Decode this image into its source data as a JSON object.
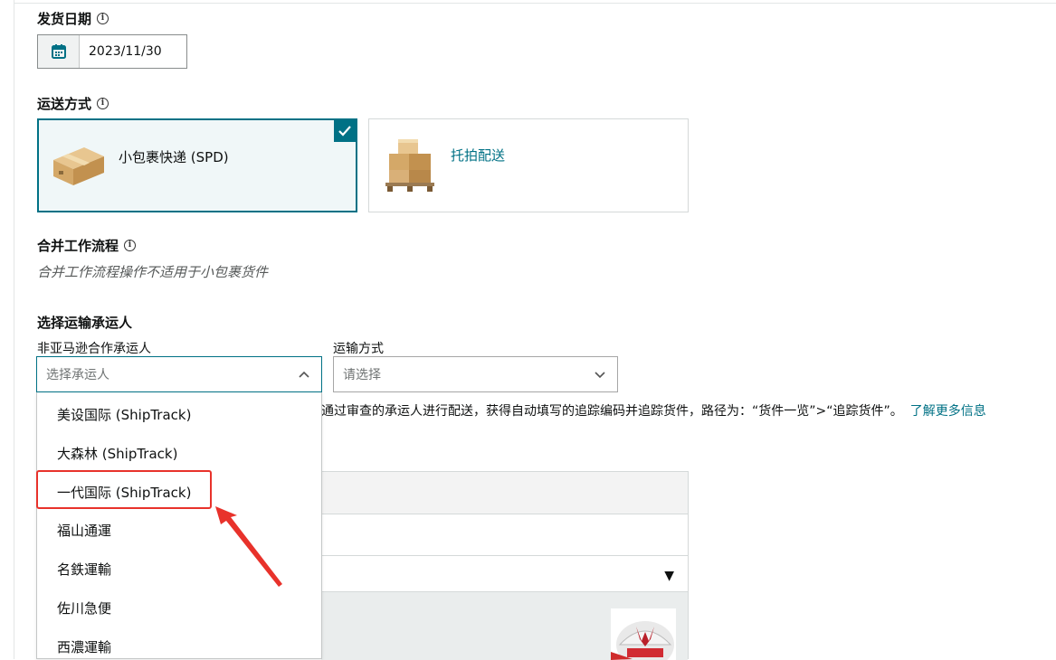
{
  "ship_date": {
    "label": "发货日期",
    "value": "2023/11/30"
  },
  "shipping_method": {
    "label": "运送方式",
    "options": [
      {
        "label": "小包裹快递 (SPD)",
        "selected": true
      },
      {
        "label": "托拍配送",
        "selected": false
      }
    ]
  },
  "merge_workflow": {
    "label": "合并工作流程",
    "note": "合并工作流程操作不适用于小包裹货件"
  },
  "carrier_section": {
    "title": "选择运输承运人",
    "carrier_label": "非亚马逊合作承运人",
    "carrier_placeholder": "选择承运人",
    "method_label": "运输方式",
    "method_placeholder": "请选择",
    "info_text": "通过审查的承运人进行配送，获得自动填写的追踪编码并追踪货件，路径为：“货件一览”>“追踪货件”。",
    "learn_more": "了解更多信息"
  },
  "carrier_options": [
    "美设国际 (ShipTrack)",
    "大森林 (ShipTrack)",
    "一代国际 (ShipTrack)",
    "福山通運",
    "名鉄運輸",
    "佐川急便",
    "西濃運輸"
  ],
  "colors": {
    "accent": "#007185",
    "highlight": "#e8322b",
    "border": "#d5d9d9"
  }
}
